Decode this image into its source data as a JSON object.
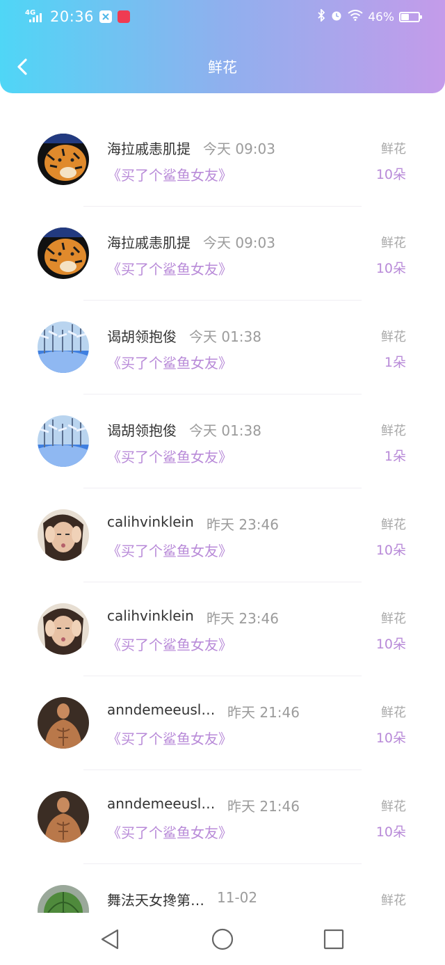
{
  "status_bar": {
    "network": "4G",
    "time": "20:36",
    "battery_percent": "46%",
    "battery_level": 0.46,
    "icons": [
      "signal-icon",
      "app-icon-notification",
      "app-icon-red",
      "bluetooth-icon",
      "alarm-icon",
      "wifi-icon",
      "battery-icon"
    ]
  },
  "header": {
    "title": "鲜花",
    "back_icon": "chevron-left-icon",
    "gradient": [
      "#4fd6f6",
      "#c49bea"
    ]
  },
  "accent_color": "#b88ad8",
  "list": [
    {
      "name": "海拉戚恚肌提",
      "time": "今天 09:03",
      "work": "《买了个鲨鱼女友》",
      "label": "鲜花",
      "count": "10朵",
      "avatar": "tiger-avatar"
    },
    {
      "name": "海拉戚恚肌提",
      "time": "今天 09:03",
      "work": "《买了个鲨鱼女友》",
      "label": "鲜花",
      "count": "10朵",
      "avatar": "tiger-avatar"
    },
    {
      "name": "谒胡领抱俊",
      "time": "今天 01:38",
      "work": "《买了个鲨鱼女友》",
      "label": "鲜花",
      "count": "1朵",
      "avatar": "snow-forest-avatar"
    },
    {
      "name": "谒胡领抱俊",
      "time": "今天 01:38",
      "work": "《买了个鲨鱼女友》",
      "label": "鲜花",
      "count": "1朵",
      "avatar": "snow-forest-avatar"
    },
    {
      "name": "calihvinklein",
      "time": "昨天 23:46",
      "work": "《买了个鲨鱼女友》",
      "label": "鲜花",
      "count": "10朵",
      "avatar": "girl-avatar"
    },
    {
      "name": "calihvinklein",
      "time": "昨天 23:46",
      "work": "《买了个鲨鱼女友》",
      "label": "鲜花",
      "count": "10朵",
      "avatar": "girl-avatar"
    },
    {
      "name": "anndemeeusl…",
      "time": "昨天 21:46",
      "work": "《买了个鲨鱼女友》",
      "label": "鲜花",
      "count": "10朵",
      "avatar": "muscle-man-avatar"
    },
    {
      "name": "anndemeeusl…",
      "time": "昨天 21:46",
      "work": "《买了个鲨鱼女友》",
      "label": "鲜花",
      "count": "10朵",
      "avatar": "muscle-man-avatar"
    },
    {
      "name": "舞法天女搀第…",
      "time": "11-02",
      "work": "",
      "label": "鲜花",
      "count": "",
      "avatar": "cactus-avatar"
    }
  ],
  "nav_bar": {
    "back": "triangle-back-icon",
    "home": "circle-home-icon",
    "recent": "square-recent-icon"
  }
}
